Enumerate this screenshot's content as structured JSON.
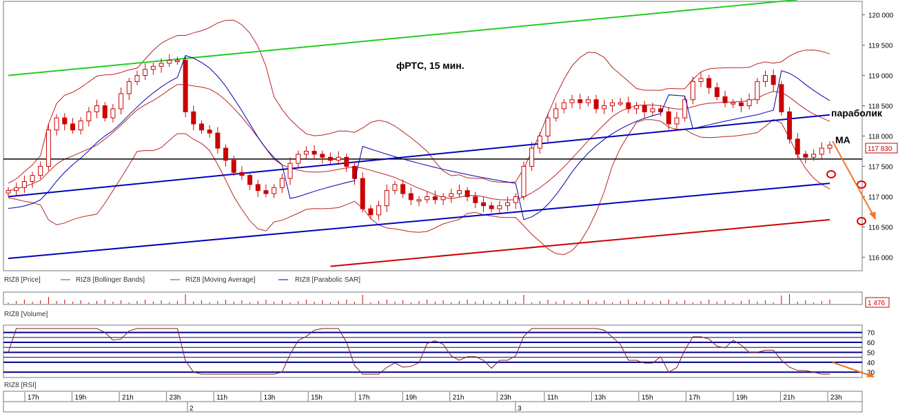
{
  "chart_data": {
    "type": "line",
    "title": "фРТС, 15 мин.",
    "price_panel": {
      "y_ticks": [
        "120 000",
        "119 500",
        "119 000",
        "118 500",
        "118 000",
        "117 500",
        "117 000",
        "116 500",
        "116 000"
      ],
      "y_values": [
        120000,
        119500,
        119000,
        118500,
        118000,
        117500,
        117000,
        116500,
        116000
      ],
      "ylim": [
        115800,
        120200
      ],
      "last_price_label": "117 830",
      "annotations": [
        "параболик",
        "МА"
      ],
      "legend": [
        "RIZ8 [Price]",
        "RIZ8 [Bollinger Bands]",
        "RIZ8 [Moving Average]",
        "RIZ8 [Parabolic SAR]"
      ],
      "close_series": [
        117100,
        117150,
        117250,
        117350,
        117500,
        118100,
        118300,
        118200,
        118100,
        118250,
        118400,
        118500,
        118300,
        118450,
        118700,
        118900,
        119000,
        119100,
        119150,
        119200,
        119250,
        119250,
        118400,
        118200,
        118100,
        118050,
        117800,
        117600,
        117400,
        117350,
        117200,
        117100,
        117050,
        117150,
        117300,
        117550,
        117700,
        117750,
        117700,
        117650,
        117600,
        117650,
        117500,
        117300,
        116800,
        116700,
        116850,
        117100,
        117200,
        117050,
        116950,
        116950,
        117000,
        116950,
        117000,
        117050,
        117100,
        117000,
        116900,
        116850,
        116800,
        116850,
        116900,
        117000,
        117500,
        117800,
        118000,
        118300,
        118450,
        118550,
        118600,
        118550,
        118600,
        118450,
        118500,
        118550,
        118550,
        118450,
        118500,
        118400,
        118450,
        118400,
        118200,
        118300,
        118600,
        118900,
        118950,
        118800,
        118650,
        118550,
        118550,
        118500,
        118600,
        118900,
        119000,
        118850,
        118400,
        117950,
        117700,
        117650,
        117700,
        117800,
        117850
      ],
      "horizontal_level": 117620,
      "trend_lines": [
        {
          "color": "#22cc22",
          "points": [
            [
              0,
              119000
            ],
            [
              98,
              120250
            ]
          ]
        },
        {
          "color": "#0000bb",
          "points": [
            [
              0,
              117000
            ],
            [
              102,
              118350
            ]
          ]
        },
        {
          "color": "#0000bb",
          "points": [
            [
              0,
              115980
            ],
            [
              102,
              117220
            ]
          ]
        },
        {
          "color": "#cc0000",
          "points": [
            [
              40,
              115850
            ],
            [
              102,
              116620
            ]
          ]
        }
      ]
    },
    "volume_panel": {
      "legend": "RIZ8 [Volume]",
      "last_value_label": "1 476"
    },
    "rsi_panel": {
      "legend": "RIZ8 [RSI]",
      "y_ticks": [
        "70",
        "60",
        "50",
        "40",
        "30"
      ],
      "y_values": [
        70,
        60,
        50,
        40,
        30
      ],
      "ylim": [
        26,
        76
      ],
      "levels": [
        30,
        40,
        50,
        60,
        70
      ]
    },
    "x_axis": {
      "time_labels": [
        "17h",
        "19h",
        "21h",
        "23h",
        "11h",
        "13h",
        "15h",
        "17h",
        "19h",
        "21h",
        "23h",
        "11h",
        "13h",
        "15h",
        "17h",
        "19h",
        "21h",
        "23h"
      ],
      "day_labels": [
        "2",
        "3"
      ]
    },
    "colors": {
      "candle_up": "#cc0000",
      "candle_down": "#cc0000",
      "bollinger": "#bb2222",
      "moving_average": "#bb2222",
      "parabolic": "#0000aa",
      "rsi_line": "#7a2222",
      "rsi_levels": "#000088",
      "arrow": "#ee7722",
      "circle": "#dd0000"
    }
  }
}
